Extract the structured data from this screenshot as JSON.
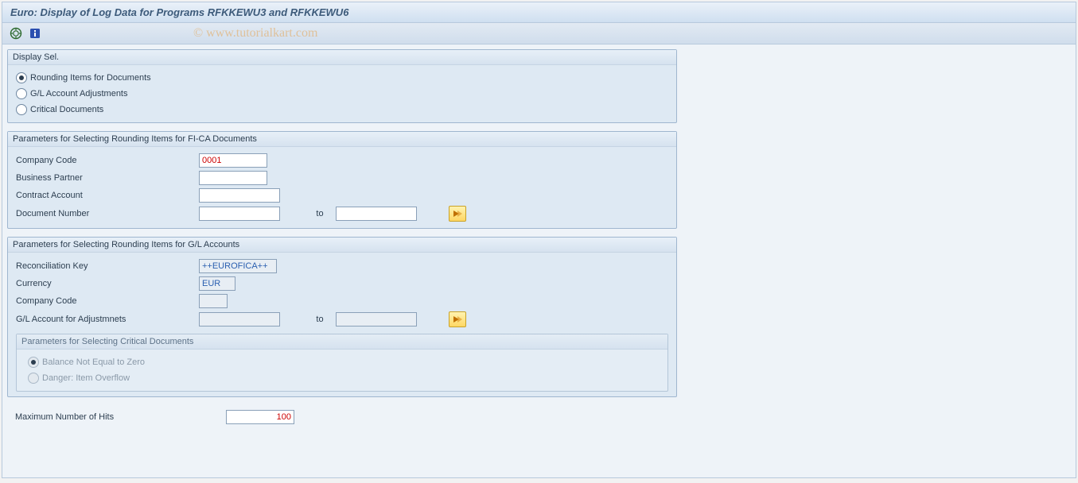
{
  "title": "Euro: Display of Log Data for Programs RFKKEWU3 and RFKKEWU6",
  "watermark": "© www.tutorialkart.com",
  "display_sel": {
    "title": "Display Sel.",
    "options": [
      "Rounding Items for Documents",
      "G/L Account Adjustments",
      "Critical Documents"
    ]
  },
  "group_fica": {
    "title": "Parameters for Selecting Rounding Items for FI-CA Documents",
    "company_code_label": "Company Code",
    "company_code_value": "0001",
    "business_partner_label": "Business Partner",
    "contract_account_label": "Contract Account",
    "document_number_label": "Document Number",
    "to_label": "to"
  },
  "group_gl": {
    "title": "Parameters for Selecting Rounding Items for G/L Accounts",
    "reconciliation_key_label": "Reconciliation Key",
    "reconciliation_key_value": "++EUROFICA++",
    "currency_label": "Currency",
    "currency_value": "EUR",
    "company_code_label": "Company Code",
    "gl_account_label": "G/L Account for Adjustmnets",
    "to_label": "to",
    "critical": {
      "title": "Parameters for Selecting Critical Documents",
      "opt1": "Balance Not Equal to Zero",
      "opt2": "Danger: Item Overflow"
    }
  },
  "max_hits": {
    "label": "Maximum Number of Hits",
    "value": "100"
  }
}
